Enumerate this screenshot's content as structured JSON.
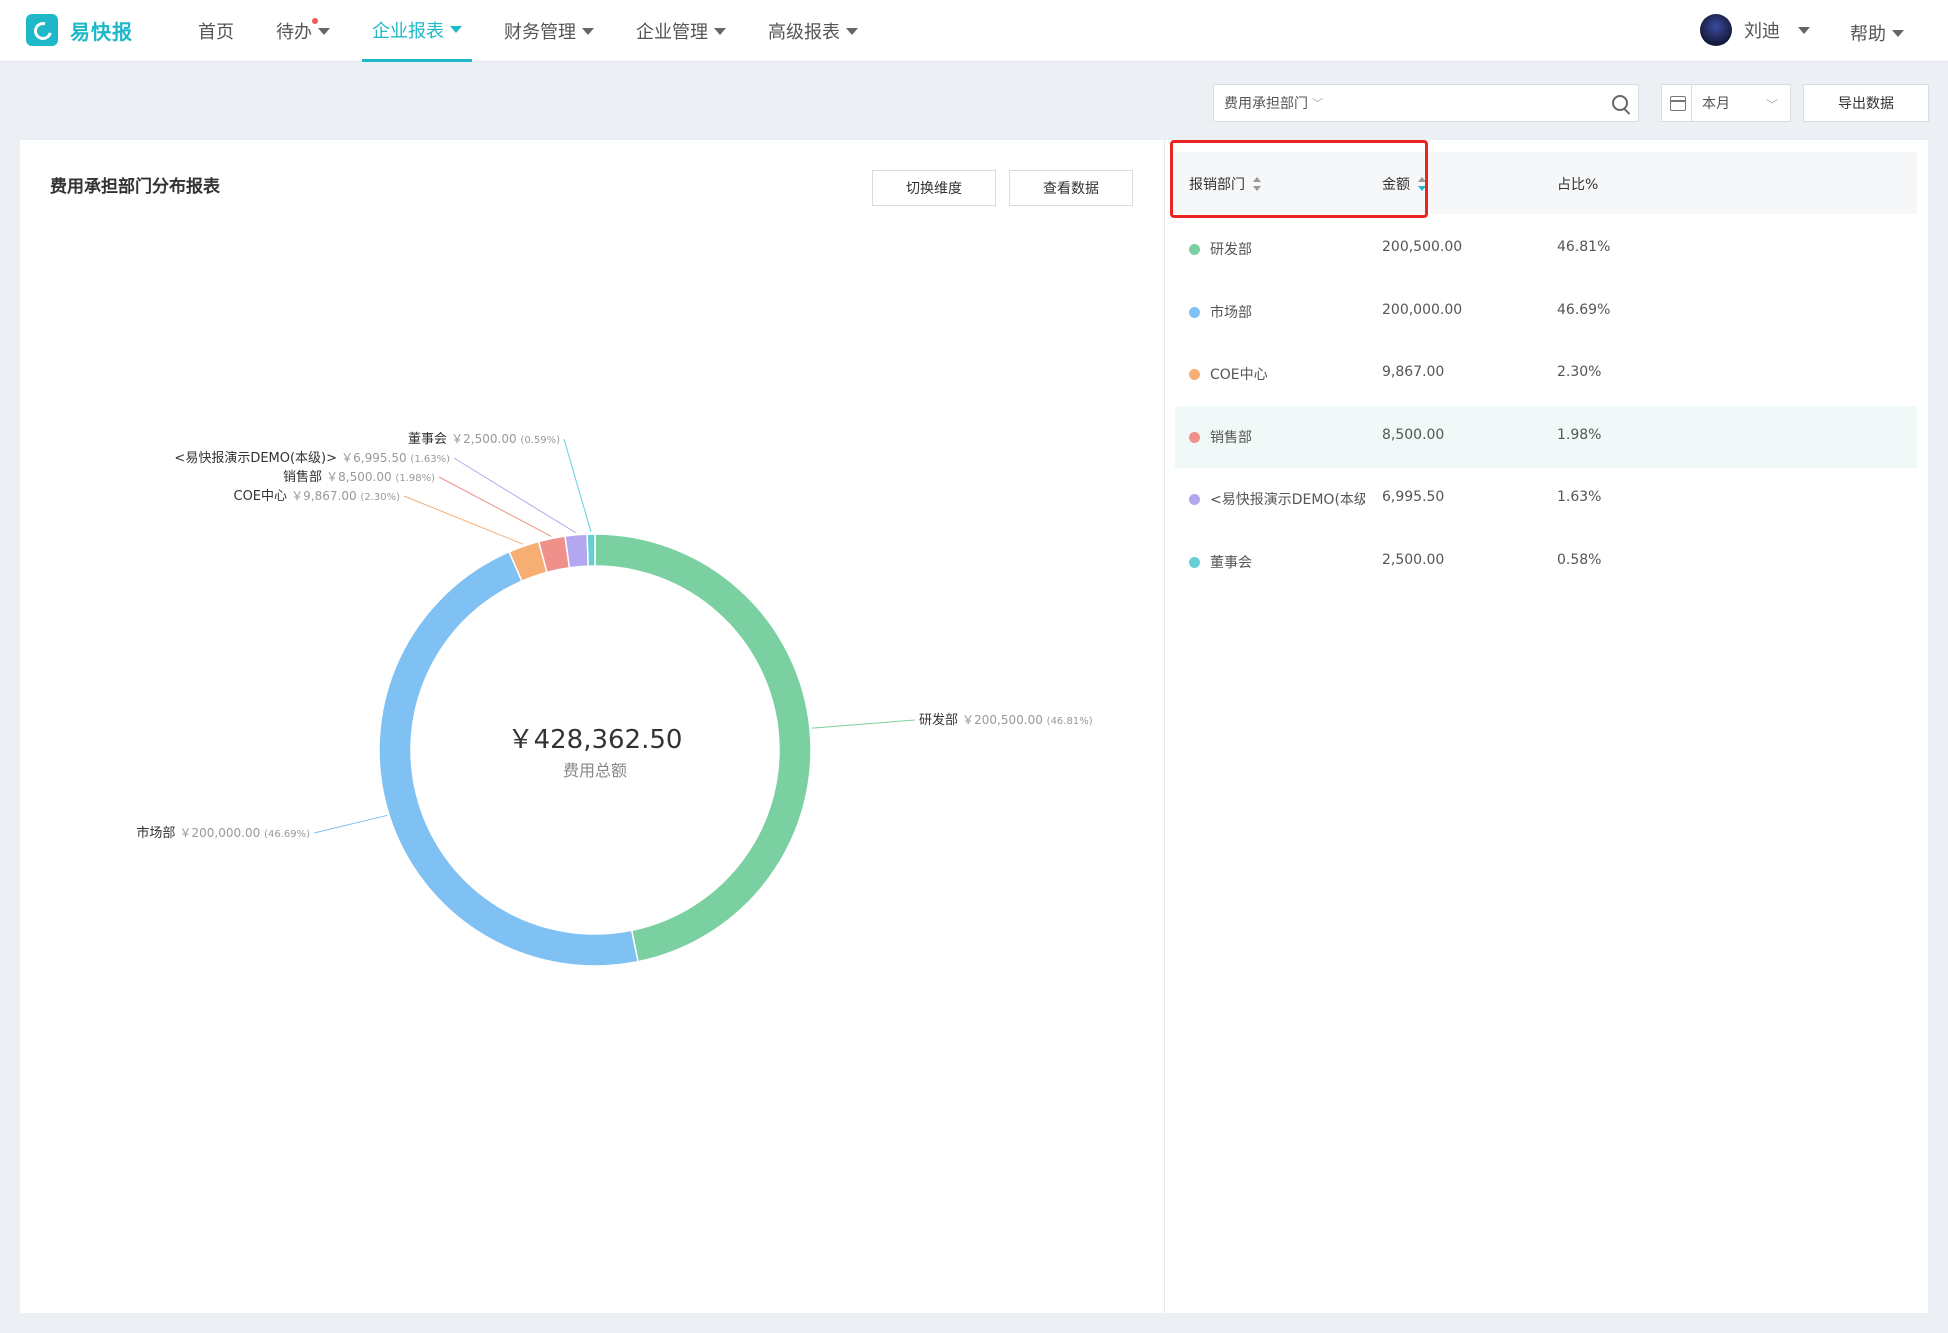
{
  "app": {
    "name": "易快报"
  },
  "nav": {
    "items": [
      {
        "label": "首页"
      },
      {
        "label": "待办"
      },
      {
        "label": "企业报表"
      },
      {
        "label": "财务管理"
      },
      {
        "label": "企业管理"
      },
      {
        "label": "高级报表"
      }
    ]
  },
  "user": {
    "name": "刘迪"
  },
  "help": {
    "label": "帮助"
  },
  "toolbar": {
    "dimension_value": "费用承担部门",
    "date_value": "本月",
    "export_label": "导出数据"
  },
  "chart_panel": {
    "title": "费用承担部门分布报表",
    "switch_label": "切换维度",
    "view_label": "查看数据",
    "center_total": "￥428,362.50",
    "center_label": "费用总额"
  },
  "table": {
    "headers": {
      "dept": "报销部门",
      "amount": "金额",
      "pct": "占比%"
    },
    "rows": [
      {
        "dept": "研发部",
        "amount": "200,500.00",
        "pct": "46.81%",
        "color": "#7ad0a0"
      },
      {
        "dept": "市场部",
        "amount": "200,000.00",
        "pct": "46.69%",
        "color": "#7fc1f2"
      },
      {
        "dept": "COE中心",
        "amount": "9,867.00",
        "pct": "2.30%",
        "color": "#f7ae73"
      },
      {
        "dept": "销售部",
        "amount": "8,500.00",
        "pct": "1.98%",
        "color": "#f0908a"
      },
      {
        "dept": "<易快报演示DEMO(本级)>",
        "amount": "6,995.50",
        "pct": "1.63%",
        "color": "#b3a8f0"
      },
      {
        "dept": "董事会",
        "amount": "2,500.00",
        "pct": "0.58%",
        "color": "#66cfd6"
      }
    ]
  },
  "chart_data": {
    "type": "pie",
    "total": 428362.5,
    "series": [
      {
        "name": "研发部",
        "value": 200500.0,
        "pct_label": "(46.81%)",
        "value_label": "￥200,500.00",
        "color": "#7ad0a0"
      },
      {
        "name": "市场部",
        "value": 200000.0,
        "pct_label": "(46.69%)",
        "value_label": "￥200,000.00",
        "color": "#7fc1f2"
      },
      {
        "name": "COE中心",
        "value": 9867.0,
        "pct_label": "(2.30%)",
        "value_label": "￥9,867.00",
        "color": "#f7ae73"
      },
      {
        "name": "销售部",
        "value": 8500.0,
        "pct_label": "(1.98%)",
        "value_label": "￥8,500.00",
        "color": "#f0908a"
      },
      {
        "name": "<易快报演示DEMO(本级)>",
        "value": 6995.5,
        "pct_label": "(1.63%)",
        "value_label": "￥6,995.50",
        "color": "#b3a8f0"
      },
      {
        "name": "董事会",
        "value": 2500.0,
        "pct_label": "(0.59%)",
        "value_label": "￥2,500.00",
        "color": "#66cfd6"
      }
    ]
  }
}
